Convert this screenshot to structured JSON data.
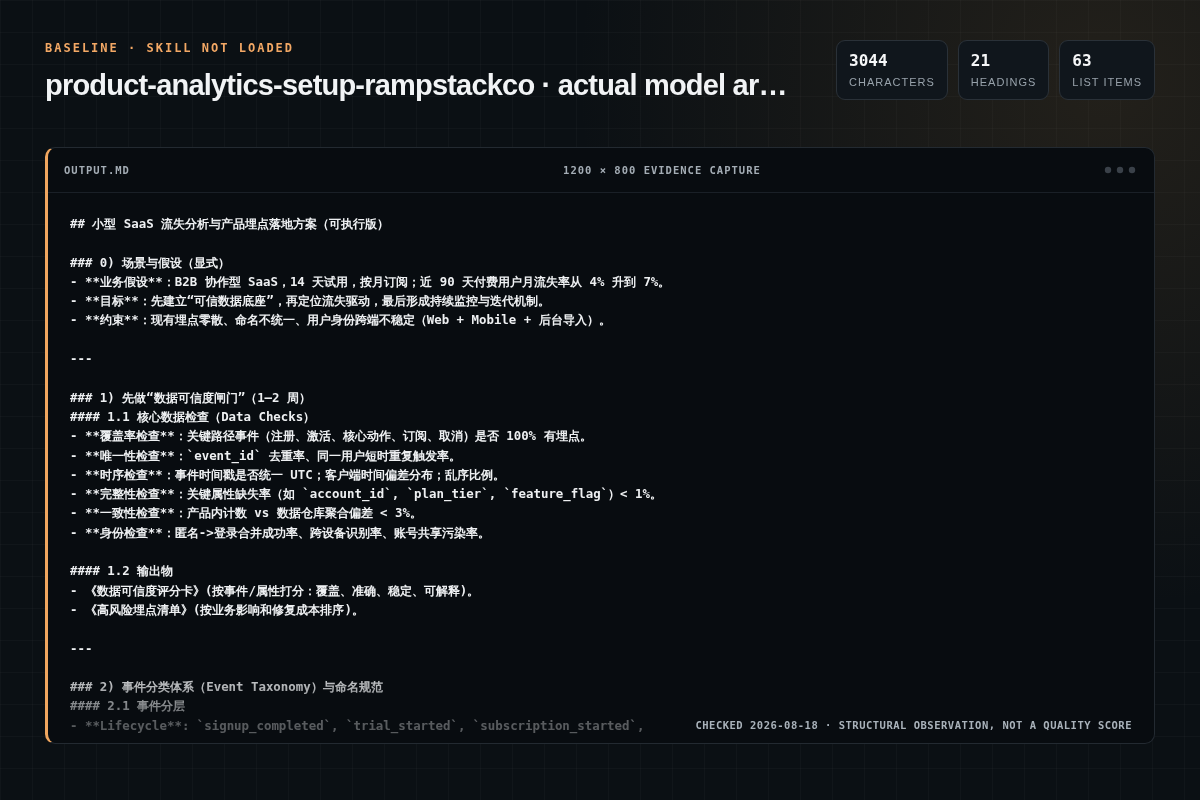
{
  "header": {
    "eyebrow": "BASELINE · SKILL NOT LOADED",
    "title": "product-analytics-setup-rampstackco · actual model ar…"
  },
  "stats": [
    {
      "value": "3044",
      "label": "CHARACTERS"
    },
    {
      "value": "21",
      "label": "HEADINGS"
    },
    {
      "value": "63",
      "label": "LIST ITEMS"
    }
  ],
  "panel": {
    "filename": "OUTPUT.MD",
    "caption": "1200 × 800 EVIDENCE CAPTURE",
    "lines": [
      {
        "kind": "text",
        "text": "## 小型 SaaS 流失分析与产品埋点落地方案（可执行版）"
      },
      {
        "kind": "blank"
      },
      {
        "kind": "text",
        "text": "### 0) 场景与假设（显式）"
      },
      {
        "kind": "text",
        "text": "- **业务假设**：B2B 协作型 SaaS，14 天试用，按月订阅；近 90 天付费用户月流失率从 4% 升到 7%。"
      },
      {
        "kind": "text",
        "text": "- **目标**：先建立“可信数据底座”，再定位流失驱动，最后形成持续监控与迭代机制。"
      },
      {
        "kind": "text",
        "text": "- **约束**：现有埋点零散、命名不统一、用户身份跨端不稳定（Web + Mobile + 后台导入）。"
      },
      {
        "kind": "blank"
      },
      {
        "kind": "text",
        "text": "---"
      },
      {
        "kind": "blank"
      },
      {
        "kind": "text",
        "text": "### 1) 先做“数据可信度闸门”（1–2 周）"
      },
      {
        "kind": "text",
        "text": "#### 1.1 核心数据检查（Data Checks）"
      },
      {
        "kind": "text",
        "text": "- **覆盖率检查**：关键路径事件（注册、激活、核心动作、订阅、取消）是否 100% 有埋点。"
      },
      {
        "kind": "text",
        "text": "- **唯一性检查**：`event_id` 去重率、同一用户短时重复触发率。"
      },
      {
        "kind": "text",
        "text": "- **时序检查**：事件时间戳是否统一 UTC；客户端时间偏差分布；乱序比例。"
      },
      {
        "kind": "text",
        "text": "- **完整性检查**：关键属性缺失率（如 `account_id`, `plan_tier`, `feature_flag`）< 1%。"
      },
      {
        "kind": "text",
        "text": "- **一致性检查**：产品内计数 vs 数据仓库聚合偏差 < 3%。"
      },
      {
        "kind": "text",
        "text": "- **身份检查**：匿名->登录合并成功率、跨设备识别率、账号共享污染率。"
      },
      {
        "kind": "blank"
      },
      {
        "kind": "text",
        "text": "#### 1.2 输出物"
      },
      {
        "kind": "text",
        "text": "- 《数据可信度评分卡》(按事件/属性打分：覆盖、准确、稳定、可解释)。"
      },
      {
        "kind": "text",
        "text": "- 《高风险埋点清单》(按业务影响和修复成本排序)。"
      },
      {
        "kind": "blank"
      },
      {
        "kind": "text",
        "text": "---"
      },
      {
        "kind": "blank"
      },
      {
        "kind": "text",
        "text": "### 2) 事件分类体系（Event Taxonomy）与命名规范"
      },
      {
        "kind": "text",
        "text": "#### 2.1 事件分层"
      },
      {
        "kind": "text",
        "text": "- **Lifecycle**: `signup_completed`, `trial_started`, `subscription_started`,"
      }
    ],
    "footnote": "CHECKED 2026-08-18 · STRUCTURAL OBSERVATION, NOT A QUALITY SCORE"
  }
}
